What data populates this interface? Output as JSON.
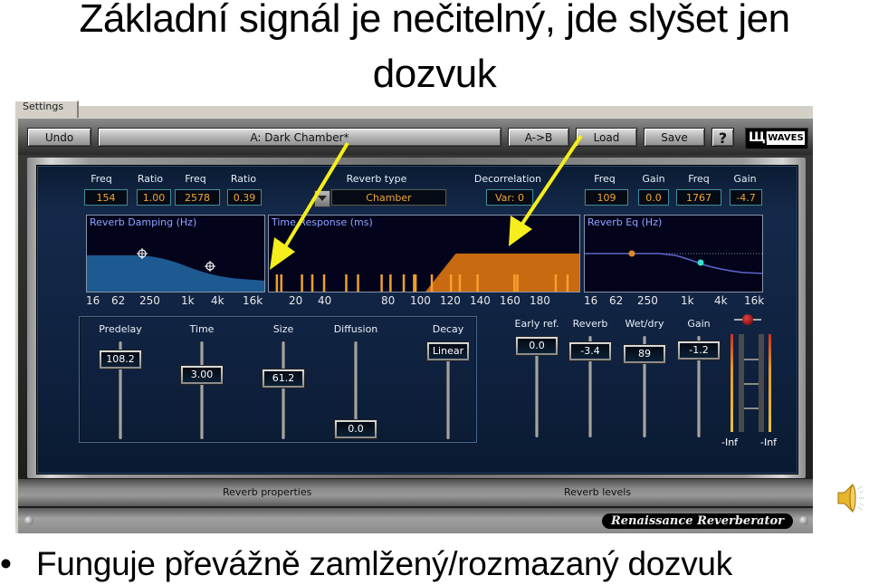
{
  "slide": {
    "title_line1": "Základní signál je nečitelný, jde slyšet jen",
    "title_line2": "dozvuk",
    "bullet_symbol": "•",
    "bullet_text": "Funguje převážně zamlžený/rozmazaný dozvuk",
    "speaker_icon": "speaker-sound-icon"
  },
  "plugin": {
    "tab_label": "Settings",
    "toolbar": {
      "undo": "Undo",
      "preset_name": "A: Dark Chamber*",
      "ab": "A->B",
      "load": "Load",
      "save": "Save",
      "help": "?",
      "logo": "WAVES"
    },
    "damping_params": [
      {
        "label": "Freq",
        "value": "154"
      },
      {
        "label": "Ratio",
        "value": "1.00"
      },
      {
        "label": "Freq",
        "value": "2578"
      },
      {
        "label": "Ratio",
        "value": "0.39"
      }
    ],
    "reverb_type": {
      "label": "Reverb type",
      "value": "Chamber"
    },
    "decorrelation": {
      "label": "Decorrelation",
      "value": "Var: 0"
    },
    "eq_params": [
      {
        "label": "Freq",
        "value": "109"
      },
      {
        "label": "Gain",
        "value": "0.0"
      },
      {
        "label": "Freq",
        "value": "1767"
      },
      {
        "label": "Gain",
        "value": "-4.7"
      }
    ],
    "graphs": {
      "damping": {
        "title": "Reverb Damping (Hz)",
        "axis": [
          "16",
          "62",
          "250",
          "1k",
          "4k",
          "16k"
        ]
      },
      "time": {
        "title": "Time Response (ms)",
        "axis": [
          "20",
          "40",
          "80",
          "100",
          "120",
          "140",
          "160",
          "180"
        ],
        "early_reflections_ms": [
          1,
          4,
          18,
          25,
          33,
          48,
          56,
          72,
          78,
          87,
          94,
          95,
          106,
          119,
          125,
          137,
          162,
          164,
          190,
          198
        ],
        "reverb_onset_ms": 102,
        "reverb_plateau_ms": 123
      },
      "eq": {
        "title": "Reverb Eq (Hz)",
        "axis": [
          "16",
          "62",
          "250",
          "1k",
          "4k",
          "16k"
        ]
      }
    },
    "properties_faders": [
      {
        "label": "Predelay",
        "value": "108.2",
        "position": 0.9
      },
      {
        "label": "Time",
        "value": "3.00",
        "position": 0.7
      },
      {
        "label": "Size",
        "value": "61.2",
        "position": 0.65
      },
      {
        "label": "Diffusion",
        "value": "0.0",
        "position": 0.0
      },
      {
        "label": "Decay",
        "value": "Linear",
        "position": 1.0
      }
    ],
    "levels_faders": [
      {
        "label": "Early ref.",
        "value": "0.0",
        "position": 1.0
      },
      {
        "label": "Reverb",
        "value": "-3.4",
        "position": 0.93
      },
      {
        "label": "Wet/dry",
        "value": "89",
        "position": 0.9
      },
      {
        "label": "Gain",
        "value": "-1.2",
        "position": 0.95
      }
    ],
    "meters": {
      "left": "-Inf",
      "right": "-Inf"
    },
    "section_labels": {
      "properties": "Reverb properties",
      "levels": "Reverb levels"
    },
    "product_name": "Renaissance Reverberator"
  },
  "colors": {
    "value_text": "#f2a635",
    "graph_title": "#8ea3ff",
    "annotation_arrow": "#f5ee1a"
  }
}
